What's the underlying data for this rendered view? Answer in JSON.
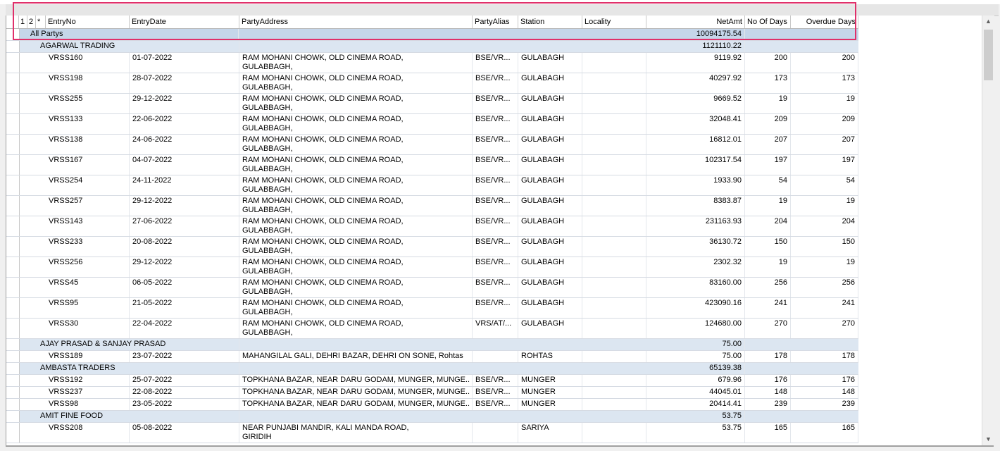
{
  "columns": {
    "c1": "1",
    "c2": "2",
    "star": "*",
    "entryno": "EntryNo",
    "entrydate": "EntryDate",
    "partyaddress": "PartyAddress",
    "partyalias": "PartyAlias",
    "station": "Station",
    "locality": "Locality",
    "netamt": "NetAmt",
    "noofdays": "No Of Days",
    "overduedays": "Overdue Days"
  },
  "rows": [
    {
      "type": "total",
      "label": "All Partys",
      "netamt": "10094175.54"
    },
    {
      "type": "group",
      "label": "AGARWAL TRADING",
      "netamt": "1121110.22"
    },
    {
      "type": "data",
      "entryno": "VRSS160",
      "date": "01-07-2022",
      "address1": "RAM MOHANI CHOWK, OLD CINEMA ROAD,",
      "address2": "GULABBAGH,",
      "alias": "BSE/VR...",
      "station": "GULABAGH",
      "locality": "",
      "netamt": "9119.92",
      "days": "200",
      "overdue": "200"
    },
    {
      "type": "data",
      "entryno": "VRSS198",
      "date": "28-07-2022",
      "address1": "RAM MOHANI CHOWK, OLD CINEMA ROAD,",
      "address2": "GULABBAGH,",
      "alias": "BSE/VR...",
      "station": "GULABAGH",
      "locality": "",
      "netamt": "40297.92",
      "days": "173",
      "overdue": "173"
    },
    {
      "type": "data",
      "entryno": "VRSS255",
      "date": "29-12-2022",
      "address1": "RAM MOHANI CHOWK, OLD CINEMA ROAD,",
      "address2": "GULABBAGH,",
      "alias": "BSE/VR...",
      "station": "GULABAGH",
      "locality": "",
      "netamt": "9669.52",
      "days": "19",
      "overdue": "19"
    },
    {
      "type": "data",
      "entryno": "VRSS133",
      "date": "22-06-2022",
      "address1": "RAM MOHANI CHOWK, OLD CINEMA ROAD,",
      "address2": "GULABBAGH,",
      "alias": "BSE/VR...",
      "station": "GULABAGH",
      "locality": "",
      "netamt": "32048.41",
      "days": "209",
      "overdue": "209"
    },
    {
      "type": "data",
      "entryno": "VRSS138",
      "date": "24-06-2022",
      "address1": "RAM MOHANI CHOWK, OLD CINEMA ROAD,",
      "address2": "GULABBAGH,",
      "alias": "BSE/VR...",
      "station": "GULABAGH",
      "locality": "",
      "netamt": "16812.01",
      "days": "207",
      "overdue": "207"
    },
    {
      "type": "data",
      "entryno": "VRSS167",
      "date": "04-07-2022",
      "address1": "RAM MOHANI CHOWK, OLD CINEMA ROAD,",
      "address2": "GULABBAGH,",
      "alias": "BSE/VR...",
      "station": "GULABAGH",
      "locality": "",
      "netamt": "102317.54",
      "days": "197",
      "overdue": "197"
    },
    {
      "type": "data",
      "entryno": "VRSS254",
      "date": "24-11-2022",
      "address1": "RAM MOHANI CHOWK, OLD CINEMA ROAD,",
      "address2": "GULABBAGH,",
      "alias": "BSE/VR...",
      "station": "GULABAGH",
      "locality": "",
      "netamt": "1933.90",
      "days": "54",
      "overdue": "54"
    },
    {
      "type": "data",
      "entryno": "VRSS257",
      "date": "29-12-2022",
      "address1": "RAM MOHANI CHOWK, OLD CINEMA ROAD,",
      "address2": "GULABBAGH,",
      "alias": "BSE/VR...",
      "station": "GULABAGH",
      "locality": "",
      "netamt": "8383.87",
      "days": "19",
      "overdue": "19"
    },
    {
      "type": "data",
      "entryno": "VRSS143",
      "date": "27-06-2022",
      "address1": "RAM MOHANI CHOWK, OLD CINEMA ROAD,",
      "address2": "GULABBAGH,",
      "alias": "BSE/VR...",
      "station": "GULABAGH",
      "locality": "",
      "netamt": "231163.93",
      "days": "204",
      "overdue": "204"
    },
    {
      "type": "data",
      "entryno": "VRSS233",
      "date": "20-08-2022",
      "address1": "RAM MOHANI CHOWK, OLD CINEMA ROAD,",
      "address2": "GULABBAGH,",
      "alias": "BSE/VR...",
      "station": "GULABAGH",
      "locality": "",
      "netamt": "36130.72",
      "days": "150",
      "overdue": "150"
    },
    {
      "type": "data",
      "entryno": "VRSS256",
      "date": "29-12-2022",
      "address1": "RAM MOHANI CHOWK, OLD CINEMA ROAD,",
      "address2": "GULABBAGH,",
      "alias": "BSE/VR...",
      "station": "GULABAGH",
      "locality": "",
      "netamt": "2302.32",
      "days": "19",
      "overdue": "19"
    },
    {
      "type": "data",
      "entryno": "VRSS45",
      "date": "06-05-2022",
      "address1": "RAM MOHANI CHOWK, OLD CINEMA ROAD,",
      "address2": "GULABBAGH,",
      "alias": "BSE/VR...",
      "station": "GULABAGH",
      "locality": "",
      "netamt": "83160.00",
      "days": "256",
      "overdue": "256"
    },
    {
      "type": "data",
      "entryno": "VRSS95",
      "date": "21-05-2022",
      "address1": "RAM MOHANI CHOWK, OLD CINEMA ROAD,",
      "address2": "GULABBAGH,",
      "alias": "BSE/VR...",
      "station": "GULABAGH",
      "locality": "",
      "netamt": "423090.16",
      "days": "241",
      "overdue": "241"
    },
    {
      "type": "data",
      "entryno": "VRSS30",
      "date": "22-04-2022",
      "address1": "RAM MOHANI CHOWK, OLD CINEMA ROAD,",
      "address2": "GULABBAGH,",
      "alias": "VRS/AT/...",
      "station": "GULABAGH",
      "locality": "",
      "netamt": "124680.00",
      "days": "270",
      "overdue": "270"
    },
    {
      "type": "group",
      "label": "AJAY PRASAD & SANJAY PRASAD",
      "netamt": "75.00"
    },
    {
      "type": "data",
      "entryno": "VRSS189",
      "date": "23-07-2022",
      "address1": "MAHANGILAL GALI, DEHRI BAZAR, DEHRI ON SONE, Rohtas",
      "address2": "",
      "alias": "",
      "station": "ROHTAS",
      "locality": "",
      "netamt": "75.00",
      "days": "178",
      "overdue": "178"
    },
    {
      "type": "group",
      "label": "AMBASTA TRADERS",
      "netamt": "65139.38"
    },
    {
      "type": "data",
      "entryno": "VRSS192",
      "date": "25-07-2022",
      "address1": "TOPKHANA BAZAR, NEAR DARU GODAM, MUNGER, MUNGE...",
      "address2": "",
      "alias": "BSE/VR...",
      "station": "MUNGER",
      "locality": "",
      "netamt": "679.96",
      "days": "176",
      "overdue": "176"
    },
    {
      "type": "data",
      "entryno": "VRSS237",
      "date": "22-08-2022",
      "address1": "TOPKHANA BAZAR, NEAR DARU GODAM, MUNGER, MUNGE...",
      "address2": "",
      "alias": "BSE/VR...",
      "station": "MUNGER",
      "locality": "",
      "netamt": "44045.01",
      "days": "148",
      "overdue": "148"
    },
    {
      "type": "data",
      "entryno": "VRSS98",
      "date": "23-05-2022",
      "address1": "TOPKHANA BAZAR, NEAR DARU GODAM, MUNGER, MUNGE...",
      "address2": "",
      "alias": "BSE/VR...",
      "station": "MUNGER",
      "locality": "",
      "netamt": "20414.41",
      "days": "239",
      "overdue": "239"
    },
    {
      "type": "group",
      "label": "AMIT FINE FOOD",
      "netamt": "53.75"
    },
    {
      "type": "data",
      "entryno": "VRSS208",
      "date": "05-08-2022",
      "address1": "NEAR PUNJABI MANDIR, KALI MANDA ROAD,",
      "address2": "GIRIDIH",
      "alias": "",
      "station": "SARIYA",
      "locality": "",
      "netamt": "53.75",
      "days": "165",
      "overdue": "165"
    }
  ],
  "scrollbar": {
    "up_glyph": "▲",
    "down_glyph": "▼"
  },
  "colors": {
    "total_row": "#c5d6ea",
    "group_row": "#dce6f1",
    "highlight": "#e0306a"
  }
}
